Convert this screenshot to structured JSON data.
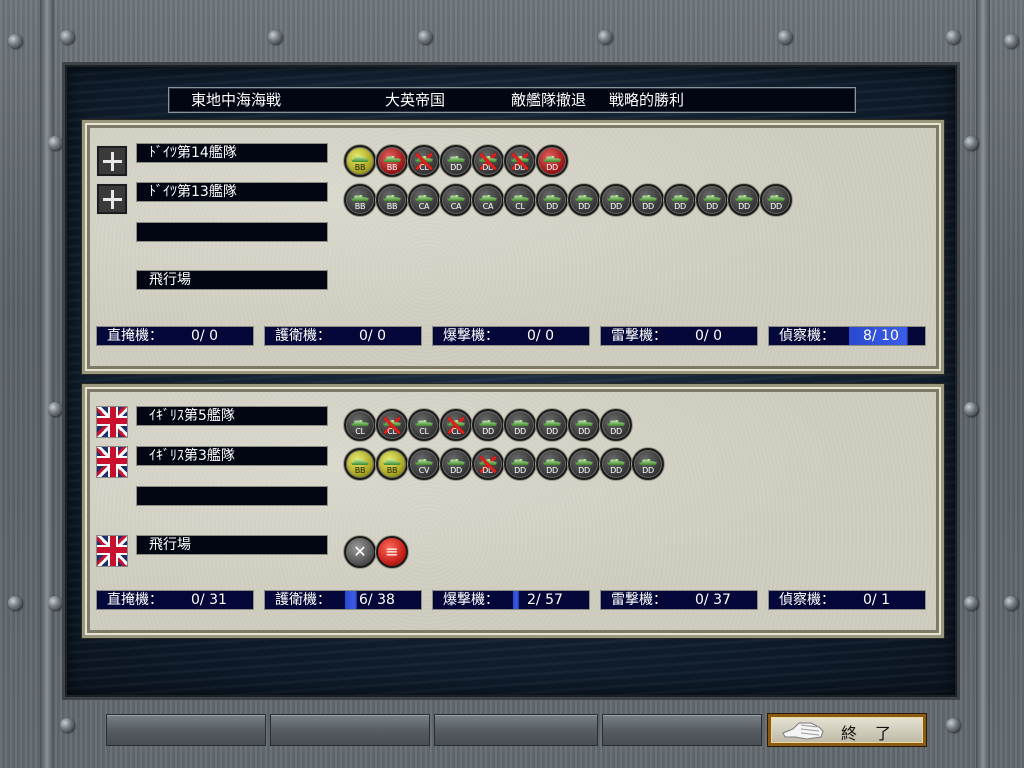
{
  "header": {
    "battle": "東地中海海戦",
    "victor": "大英帝国",
    "event": "敵艦隊撤退",
    "result": "戦略的勝利"
  },
  "axis": {
    "flag": "germany-flag-icon",
    "fleets": [
      {
        "name": "ﾄﾞｲﾂ第14艦隊",
        "ships": [
          {
            "cls": "BB",
            "state": "yellow"
          },
          {
            "cls": "BB",
            "state": "red"
          },
          {
            "cls": "CL",
            "state": "sunk"
          },
          {
            "cls": "DD",
            "state": "dark"
          },
          {
            "cls": "DD",
            "state": "sunk"
          },
          {
            "cls": "DD",
            "state": "sunk"
          },
          {
            "cls": "DD",
            "state": "red"
          }
        ]
      },
      {
        "name": "ﾄﾞｲﾂ第13艦隊",
        "ships": [
          {
            "cls": "BB",
            "state": "dark"
          },
          {
            "cls": "BB",
            "state": "dark"
          },
          {
            "cls": "CA",
            "state": "dark"
          },
          {
            "cls": "CA",
            "state": "dark"
          },
          {
            "cls": "CA",
            "state": "dark"
          },
          {
            "cls": "CL",
            "state": "dark"
          },
          {
            "cls": "DD",
            "state": "dark"
          },
          {
            "cls": "DD",
            "state": "dark"
          },
          {
            "cls": "DD",
            "state": "dark"
          },
          {
            "cls": "DD",
            "state": "dark"
          },
          {
            "cls": "DD",
            "state": "dark"
          },
          {
            "cls": "DD",
            "state": "dark"
          },
          {
            "cls": "DD",
            "state": "dark"
          },
          {
            "cls": "DD",
            "state": "dark"
          }
        ]
      },
      {
        "name": "",
        "ships": []
      }
    ],
    "airfield": "飛行場",
    "stats": [
      {
        "label": "直掩機：",
        "value": "0/ 0",
        "fill": 0
      },
      {
        "label": "護衛機：",
        "value": "0/ 0",
        "fill": 0
      },
      {
        "label": "爆撃機：",
        "value": "0/ 0",
        "fill": 0
      },
      {
        "label": "雷撃機：",
        "value": "0/ 0",
        "fill": 0
      },
      {
        "label": "偵察機：",
        "value": "8/ 10",
        "fill": 0.8
      }
    ]
  },
  "allies": {
    "flag": "union-jack-flag-icon",
    "fleets": [
      {
        "name": "ｲｷﾞﾘｽ第5艦隊",
        "ships": [
          {
            "cls": "CL",
            "state": "dark"
          },
          {
            "cls": "CL",
            "state": "sunk"
          },
          {
            "cls": "CL",
            "state": "dark"
          },
          {
            "cls": "CL",
            "state": "sunk"
          },
          {
            "cls": "DD",
            "state": "dark"
          },
          {
            "cls": "DD",
            "state": "dark"
          },
          {
            "cls": "DD",
            "state": "dark"
          },
          {
            "cls": "DD",
            "state": "dark"
          },
          {
            "cls": "DD",
            "state": "dark"
          }
        ]
      },
      {
        "name": "ｲｷﾞﾘｽ第3艦隊",
        "ships": [
          {
            "cls": "BB",
            "state": "yellow"
          },
          {
            "cls": "BB",
            "state": "yellow"
          },
          {
            "cls": "CV",
            "state": "dark"
          },
          {
            "cls": "DD",
            "state": "dark"
          },
          {
            "cls": "DD",
            "state": "sunk"
          },
          {
            "cls": "DD",
            "state": "dark"
          },
          {
            "cls": "DD",
            "state": "dark"
          },
          {
            "cls": "DD",
            "state": "dark"
          },
          {
            "cls": "DD",
            "state": "dark"
          },
          {
            "cls": "DD",
            "state": "dark"
          }
        ]
      },
      {
        "name": "",
        "ships": []
      }
    ],
    "airfield": "飛行場",
    "airfield_icons": [
      "crossed-guns-icon",
      "red-banner-icon"
    ],
    "stats": [
      {
        "label": "直掩機：",
        "value": "0/ 31",
        "fill": 0
      },
      {
        "label": "護衛機：",
        "value": "6/ 38",
        "fill": 0.16
      },
      {
        "label": "爆撃機：",
        "value": "2/ 57",
        "fill": 0.04
      },
      {
        "label": "雷撃機：",
        "value": "0/ 37",
        "fill": 0
      },
      {
        "label": "偵察機：",
        "value": "0/ 1",
        "fill": 0
      }
    ]
  },
  "end_button": {
    "label": "終了",
    "icon": "glove-icon"
  },
  "colors": {
    "name_bg": "#020512",
    "stat_bg": "#03073a",
    "highlight": "#2a4ad0",
    "panel": "#cfcdbf"
  }
}
